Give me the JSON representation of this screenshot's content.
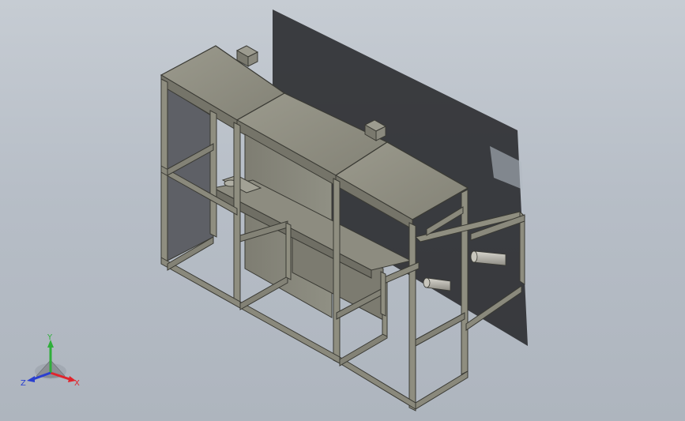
{
  "viewport": {
    "background_top": "#c6ccd3",
    "background_bottom": "#aeb5be"
  },
  "model": {
    "frame_color": "#8f8e80",
    "frame_edge_color": "#3a3a34",
    "panel_color": "#86857a",
    "shadow_color": "#2b2c30",
    "roller_color": "#b9b7ae"
  },
  "triad": {
    "x_label": "X",
    "y_label": "Y",
    "z_label": "Z",
    "x_color": "#e0242c",
    "y_color": "#2fae3a",
    "z_color": "#2a3fd0"
  }
}
